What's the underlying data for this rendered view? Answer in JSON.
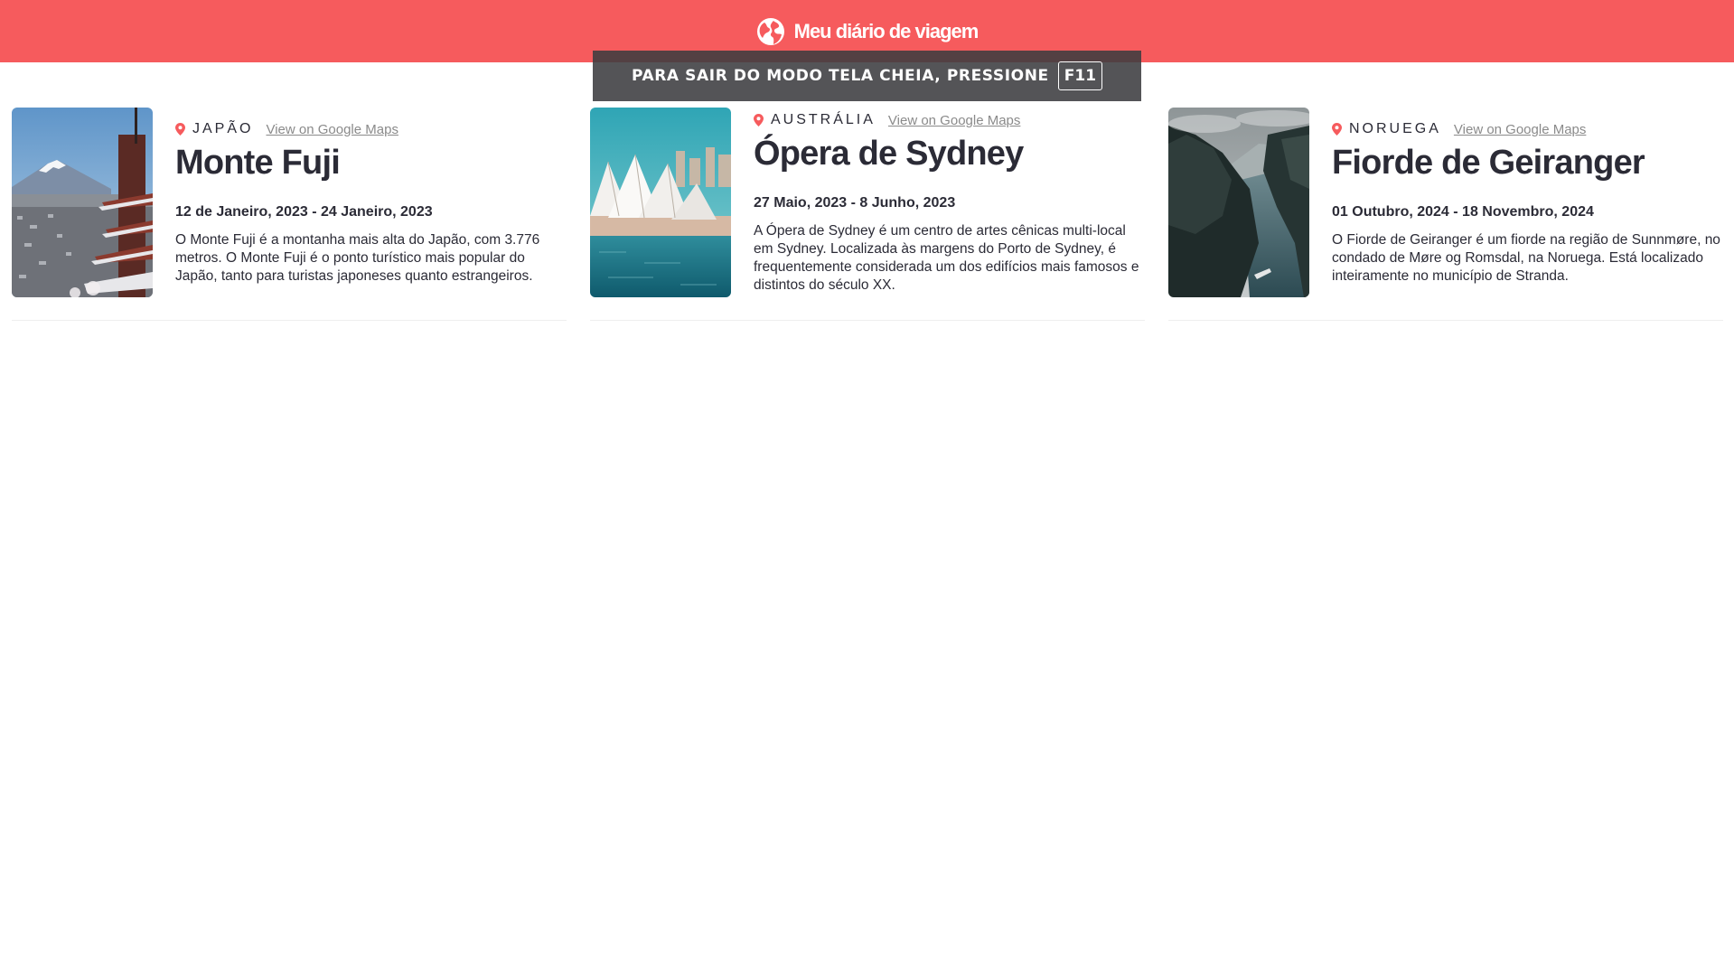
{
  "header": {
    "title": "Meu diário de viagem",
    "icon": "globe-icon",
    "background": "#f65b5d"
  },
  "fullscreen_notice": {
    "text": "PARA SAIR DO MODO TELA CHEIA, PRESSIONE",
    "key": "F11"
  },
  "entries": [
    {
      "country": "JAPÃO",
      "maps_link": "View on Google Maps",
      "title": "Monte Fuji",
      "dates": "12 de Janeiro, 2023 - 24 Janeiro, 2023",
      "description": "O Monte Fuji é a montanha mais alta do Japão, com 3.776 metros. O Monte Fuji é o ponto turístico mais popular do Japão, tanto para turistas japoneses quanto estrangeiros."
    },
    {
      "country": "AUSTRÁLIA",
      "maps_link": "View on Google Maps",
      "title": "Ópera de Sydney",
      "dates": "27 Maio, 2023 - 8 Junho, 2023",
      "description": "A Ópera de Sydney é um centro de artes cênicas multi-local em Sydney. Localizada às margens do Porto de Sydney, é frequentemente considerada um dos edifícios mais famosos e distintos do século XX."
    },
    {
      "country": "NORUEGA",
      "maps_link": "View on Google Maps",
      "title": "Fiorde de Geiranger",
      "dates": "01 Outubro, 2024 - 18 Novembro, 2024",
      "description": "O Fiorde de Geiranger é um fiorde na região de Sunnmøre, no condado de Møre og Romsdal, na Noruega. Está localizado inteiramente no município de Stranda."
    }
  ],
  "colors": {
    "accent": "#f65b5d",
    "text": "#2b2b36",
    "link": "#8a8a8a"
  }
}
